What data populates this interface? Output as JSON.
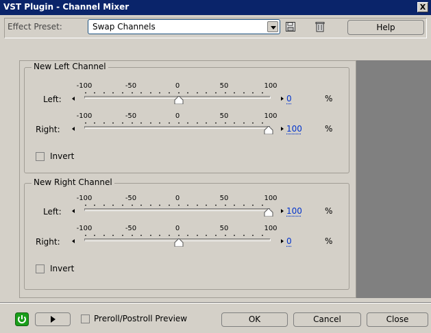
{
  "window": {
    "title": "VST Plugin - Channel Mixer",
    "close_label": "X"
  },
  "preset": {
    "label": "Effect Preset:",
    "selected": "Swap Channels"
  },
  "buttons": {
    "help": "Help",
    "ok": "OK",
    "cancel": "Cancel",
    "close": "Close"
  },
  "scale_labels": [
    "-100",
    "-50",
    "0",
    "50",
    "100"
  ],
  "groups": [
    {
      "title": "New Left Channel",
      "rows": [
        {
          "label": "Left:",
          "value": "0",
          "unit": "%"
        },
        {
          "label": "Right:",
          "value": "100",
          "unit": "%"
        }
      ],
      "invert_label": "Invert"
    },
    {
      "title": "New Right Channel",
      "rows": [
        {
          "label": "Left:",
          "value": "100",
          "unit": "%"
        },
        {
          "label": "Right:",
          "value": "0",
          "unit": "%"
        }
      ],
      "invert_label": "Invert"
    }
  ],
  "footer": {
    "preview_label": "Preroll/Postroll Preview"
  },
  "colors": {
    "title_bar": "#0a246a",
    "value_link": "#0033cc",
    "power": "#1a9e1a"
  },
  "icons": [
    "save-preset-icon",
    "delete-preset-icon",
    "power-icon",
    "play-icon"
  ]
}
